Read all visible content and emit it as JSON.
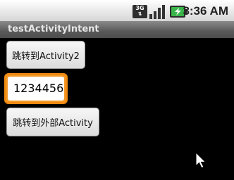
{
  "status_bar": {
    "network_label": "3G",
    "clock": "3:36 AM",
    "icons": [
      "signal-3g-icon",
      "signal-bars-icon",
      "battery-charging-icon"
    ]
  },
  "app": {
    "title": "testActivityIntent"
  },
  "buttons": {
    "go_activity2": "跳转到Activity2",
    "go_external": "跳转到外部Activity"
  },
  "input": {
    "value": "1234456"
  },
  "colors": {
    "focus_border": "#f08a12",
    "title_bar": "#5a5a5a",
    "battery_accent": "#39b54a"
  }
}
